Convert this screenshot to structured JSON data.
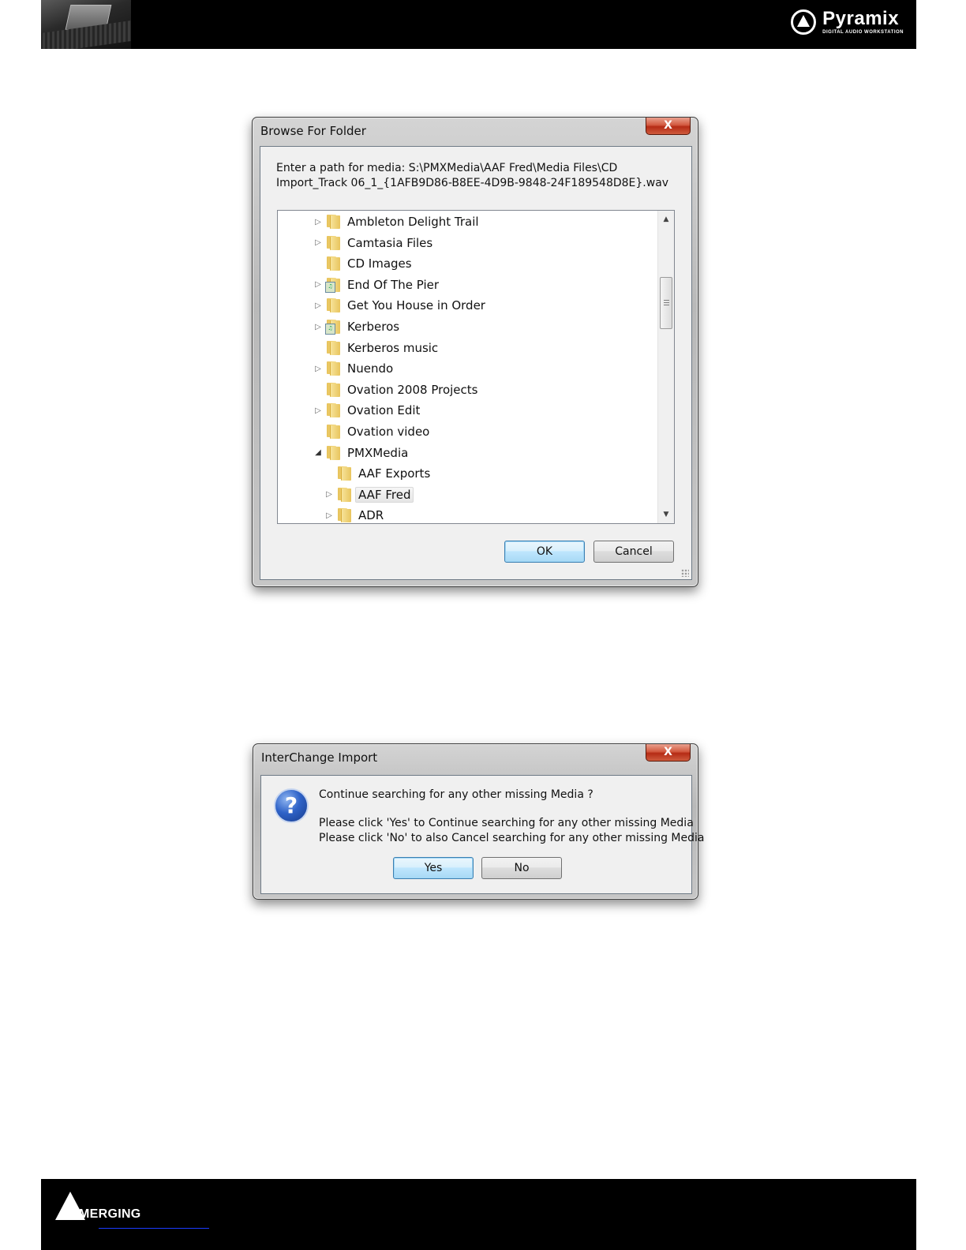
{
  "header": {
    "brand_name": "Pyramix",
    "brand_tagline": "DIGITAL AUDIO WORKSTATION",
    "brand_icon": "pyramix-logo-icon"
  },
  "footer": {
    "company": "MERGING",
    "company_icon": "merging-triangle-logo"
  },
  "browse_dialog": {
    "title": "Browse For Folder",
    "close_label": "X",
    "prompt_line1": "Enter a path for media: S:\\PMXMedia\\AAF Fred\\Media Files\\CD",
    "prompt_line2": "Import_Track 06_1_{1AFB9D86-B8EE-4D9B-9848-24F189548D8E}.wav",
    "folders": [
      {
        "label": "Ambleton Delight Trail",
        "expander": "▷",
        "badge": ""
      },
      {
        "label": "Camtasia Files",
        "expander": "▷",
        "badge": ""
      },
      {
        "label": "CD Images",
        "expander": "",
        "badge": ""
      },
      {
        "label": "End Of The Pier",
        "expander": "▷",
        "badge": "♫"
      },
      {
        "label": "Get You House in Order",
        "expander": "▷",
        "badge": ""
      },
      {
        "label": "Kerberos",
        "expander": "▷",
        "badge": "♫"
      },
      {
        "label": "Kerberos music",
        "expander": "",
        "badge": ""
      },
      {
        "label": "Nuendo",
        "expander": "▷",
        "badge": ""
      },
      {
        "label": "Ovation 2008 Projects",
        "expander": "",
        "badge": ""
      },
      {
        "label": "Ovation Edit",
        "expander": "▷",
        "badge": ""
      },
      {
        "label": "Ovation video",
        "expander": "",
        "badge": ""
      },
      {
        "label": "PMXMedia",
        "expander": "◢",
        "badge": ""
      },
      {
        "label": "AAF Exports",
        "expander": "",
        "badge": ""
      },
      {
        "label": "AAF Fred",
        "expander": "▷",
        "badge": ""
      },
      {
        "label": "ADR",
        "expander": "▷",
        "badge": ""
      }
    ],
    "ok_label": "OK",
    "cancel_label": "Cancel"
  },
  "interchange_dialog": {
    "title": "InterChange Import",
    "close_label": "X",
    "icon": "question-icon",
    "question": "Continue searching for any other missing Media ?",
    "line_yes": "Please click 'Yes' to Continue searching for any other missing Media",
    "line_no": "Please click 'No' to also Cancel searching for any other missing Media",
    "yes_label": "Yes",
    "no_label": "No"
  }
}
